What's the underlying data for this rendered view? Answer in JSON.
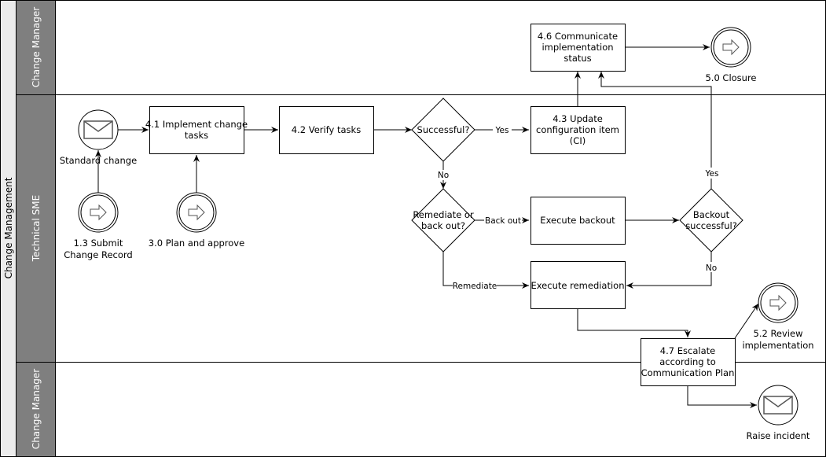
{
  "pool": {
    "label": "Change Management",
    "lanes": [
      {
        "id": "lane-top",
        "label": "Change Manager"
      },
      {
        "id": "lane-mid",
        "label": "Technical SME"
      },
      {
        "id": "lane-bottom",
        "label": "Change Manager"
      }
    ]
  },
  "nodes": {
    "standard_change": {
      "type": "message-event",
      "label": "Standard change"
    },
    "submit_change_record": {
      "type": "link-event",
      "label_lines": [
        "1.3 Submit",
        "Change Record"
      ]
    },
    "plan_and_approve": {
      "type": "link-event",
      "label": "3.0 Plan and approve"
    },
    "implement_tasks": {
      "type": "task",
      "label_lines": [
        "4.1 Implement change",
        "tasks"
      ]
    },
    "verify_tasks": {
      "type": "task",
      "label_lines": [
        "4.2 Verify tasks"
      ]
    },
    "successful": {
      "type": "gateway",
      "label_lines": [
        "Successful?"
      ]
    },
    "update_ci": {
      "type": "task",
      "label_lines": [
        "4.3 Update",
        "configuration item",
        "(CI)"
      ]
    },
    "communicate_status": {
      "type": "task",
      "label_lines": [
        "4.6 Communicate",
        "implementation",
        "status"
      ]
    },
    "closure": {
      "type": "link-event",
      "label": "5.0 Closure"
    },
    "remediate_or_backout": {
      "type": "gateway",
      "label_lines": [
        "Remediate or",
        "back out?"
      ]
    },
    "execute_backout": {
      "type": "task",
      "label_lines": [
        "Execute backout"
      ]
    },
    "backout_successful": {
      "type": "gateway",
      "label_lines": [
        "Backout",
        "successful?"
      ]
    },
    "execute_remediation": {
      "type": "task",
      "label_lines": [
        "Execute remediation"
      ]
    },
    "escalate": {
      "type": "task",
      "label_lines": [
        "4.7 Escalate",
        "according to",
        "Communication Plan"
      ]
    },
    "review_implementation": {
      "type": "link-event",
      "label_lines": [
        "5.2 Review",
        "implementation"
      ]
    },
    "raise_incident": {
      "type": "message-event",
      "label": "Raise incident"
    }
  },
  "edge_labels": {
    "yes_1": "Yes",
    "no_1": "No",
    "back_out": "Back out",
    "remediate": "Remediate",
    "yes_2": "Yes",
    "no_2": "No"
  },
  "colors": {
    "pool_header": "#ececec",
    "lane_header": "#7f7f7f",
    "stroke": "#000000"
  }
}
